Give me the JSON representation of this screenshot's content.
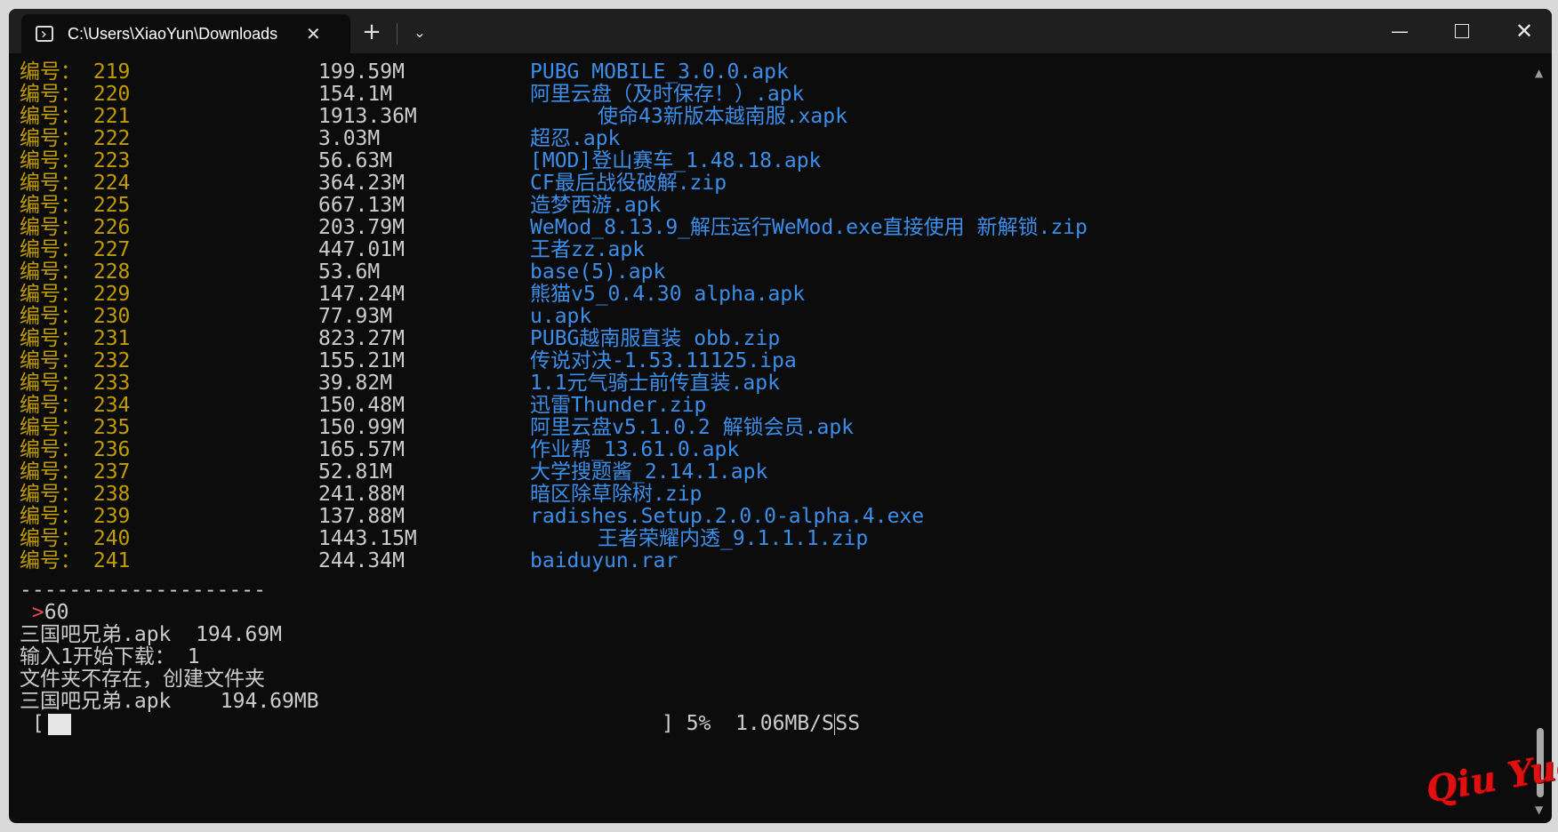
{
  "window": {
    "tab_title": "C:\\Users\\XiaoYun\\Downloads",
    "tab_close": "✕",
    "new_tab": "+",
    "dropdown": "⌄",
    "minimize": "—",
    "close": "✕"
  },
  "listing": [
    {
      "label": "编号： 219",
      "size": "199.59M",
      "name": "PUBG MOBILE_3.0.0.apk",
      "indent": false
    },
    {
      "label": "编号： 220",
      "size": "154.1M",
      "name": "阿里云盘（及时保存！）.apk",
      "indent": false
    },
    {
      "label": "编号： 221",
      "size": "1913.36M",
      "name": "使命43新版本越南服.xapk",
      "indent": true
    },
    {
      "label": "编号： 222",
      "size": "3.03M",
      "name": "超忍.apk",
      "indent": false
    },
    {
      "label": "编号： 223",
      "size": "56.63M",
      "name": "[MOD]登山赛车_1.48.18.apk",
      "indent": false
    },
    {
      "label": "编号： 224",
      "size": "364.23M",
      "name": "CF最后战役破解.zip",
      "indent": false
    },
    {
      "label": "编号： 225",
      "size": "667.13M",
      "name": "造梦西游.apk",
      "indent": false
    },
    {
      "label": "编号： 226",
      "size": "203.79M",
      "name": "WeMod_8.13.9_解压运行WeMod.exe直接使用 新解锁.zip",
      "indent": false
    },
    {
      "label": "编号： 227",
      "size": "447.01M",
      "name": "王者zz.apk",
      "indent": false
    },
    {
      "label": "编号： 228",
      "size": "53.6M",
      "name": "base(5).apk",
      "indent": false
    },
    {
      "label": "编号： 229",
      "size": "147.24M",
      "name": "熊猫v5_0.4.30 alpha.apk",
      "indent": false
    },
    {
      "label": "编号： 230",
      "size": "77.93M",
      "name": "u.apk",
      "indent": false
    },
    {
      "label": "编号： 231",
      "size": "823.27M",
      "name": "PUBG越南服直装 obb.zip",
      "indent": false
    },
    {
      "label": "编号： 232",
      "size": "155.21M",
      "name": "传说对决-1.53.11125.ipa",
      "indent": false
    },
    {
      "label": "编号： 233",
      "size": "39.82M",
      "name": "1.1元气骑士前传直装.apk",
      "indent": false
    },
    {
      "label": "编号： 234",
      "size": "150.48M",
      "name": "迅雷Thunder.zip",
      "indent": false
    },
    {
      "label": "编号： 235",
      "size": "150.99M",
      "name": "阿里云盘v5.1.0.2 解锁会员.apk",
      "indent": false
    },
    {
      "label": "编号： 236",
      "size": "165.57M",
      "name": "作业帮_13.61.0.apk",
      "indent": false
    },
    {
      "label": "编号： 237",
      "size": "52.81M",
      "name": "大学搜题酱_2.14.1.apk",
      "indent": false
    },
    {
      "label": "编号： 238",
      "size": "241.88M",
      "name": "暗区除草除树.zip",
      "indent": false
    },
    {
      "label": "编号： 239",
      "size": "137.88M",
      "name": "radishes.Setup.2.0.0-alpha.4.exe",
      "indent": false
    },
    {
      "label": "编号： 240",
      "size": "1443.15M",
      "name": "王者荣耀内透_9.1.1.1.zip",
      "indent": true
    },
    {
      "label": "编号： 241",
      "size": "244.34M",
      "name": "baiduyun.rar",
      "indent": false
    }
  ],
  "separator": "--------------------",
  "prompt": {
    "mark": ">",
    "input": "60"
  },
  "output": [
    "三国吧兄弟.apk  194.69M",
    "输入1开始下载： 1",
    "文件夹不存在，创建文件夹",
    "三国吧兄弟.apk    194.69MB"
  ],
  "progress": {
    "open": "[",
    "close": "] 5%  1.06MB/S",
    "tail": "SS",
    "fraction": 0.05
  },
  "scrollbar": {
    "up": "▲",
    "down": "▼"
  },
  "watermark": "Qiu Yue"
}
